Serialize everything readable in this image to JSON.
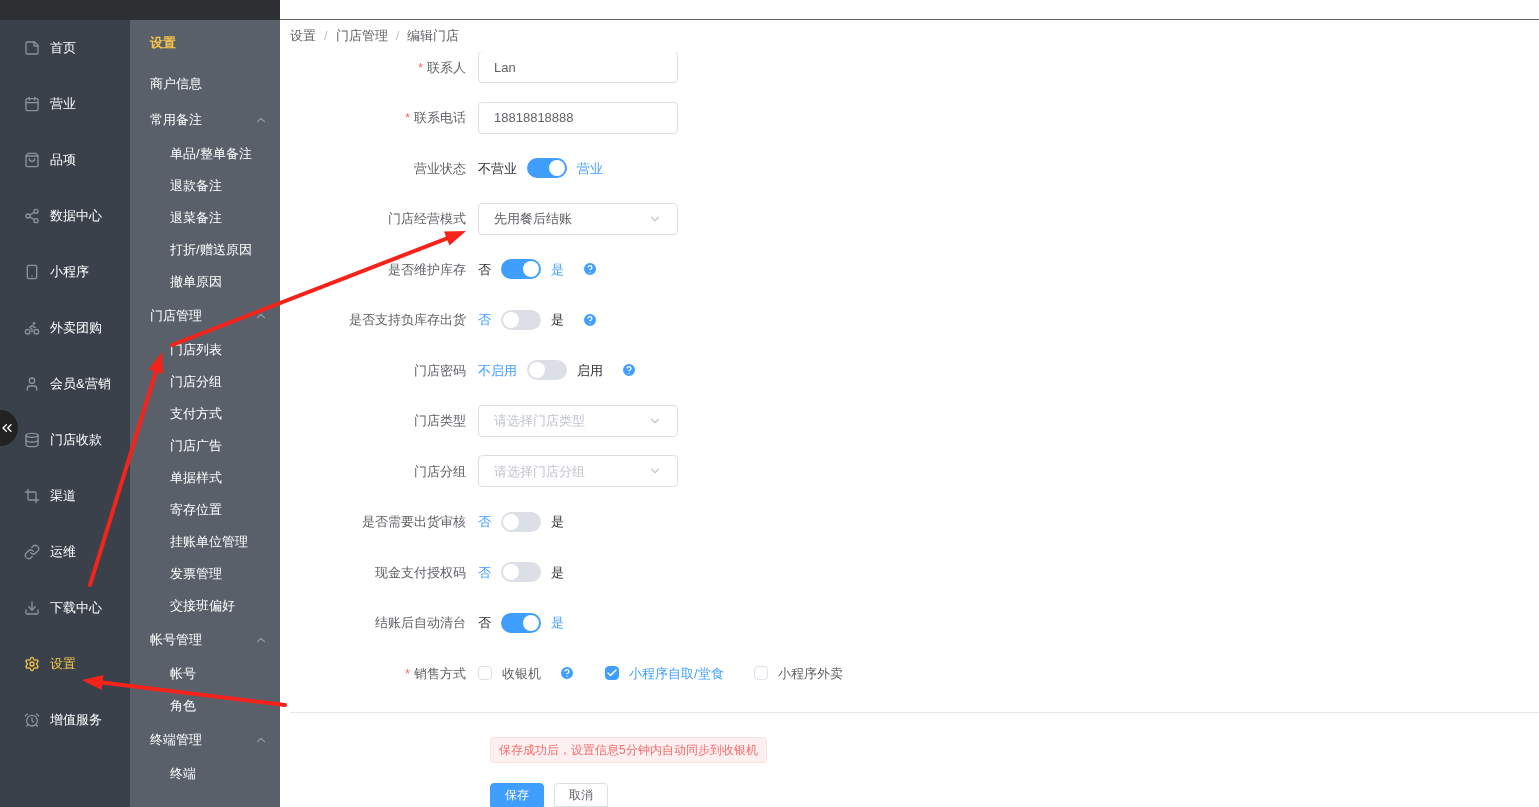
{
  "nav": [
    {
      "label": "首页",
      "selected": false
    },
    {
      "label": "营业",
      "selected": false
    },
    {
      "label": "品项",
      "selected": false
    },
    {
      "label": "数据中心",
      "selected": false
    },
    {
      "label": "小程序",
      "selected": false
    },
    {
      "label": "外卖团购",
      "selected": false
    },
    {
      "label": "会员&营销",
      "selected": false
    },
    {
      "label": "门店收款",
      "selected": false
    },
    {
      "label": "渠道",
      "selected": false
    },
    {
      "label": "运维",
      "selected": false
    },
    {
      "label": "下载中心",
      "selected": false
    },
    {
      "label": "设置",
      "selected": true
    },
    {
      "label": "增值服务",
      "selected": false
    }
  ],
  "subnav": {
    "title": "设置",
    "items": [
      {
        "kind": "link",
        "label": "商户信息"
      },
      {
        "kind": "group",
        "label": "常用备注",
        "expanded": true,
        "children": [
          {
            "label": "单品/整单备注"
          },
          {
            "label": "退款备注"
          },
          {
            "label": "退菜备注"
          },
          {
            "label": "打折/赠送原因"
          },
          {
            "label": "撤单原因"
          }
        ]
      },
      {
        "kind": "group",
        "label": "门店管理",
        "expanded": true,
        "children": [
          {
            "label": "门店列表"
          },
          {
            "label": "门店分组"
          },
          {
            "label": "支付方式"
          },
          {
            "label": "门店广告"
          },
          {
            "label": "单据样式"
          },
          {
            "label": "寄存位置"
          },
          {
            "label": "挂账单位管理"
          },
          {
            "label": "发票管理"
          },
          {
            "label": "交接班偏好"
          }
        ]
      },
      {
        "kind": "group",
        "label": "帐号管理",
        "expanded": true,
        "children": [
          {
            "label": "帐号"
          },
          {
            "label": "角色"
          }
        ]
      },
      {
        "kind": "group",
        "label": "终端管理",
        "expanded": true,
        "children": [
          {
            "label": "终端"
          }
        ]
      }
    ]
  },
  "breadcrumb": [
    "设置",
    "门店管理",
    "编辑门店"
  ],
  "breadcrumb_separator": "/",
  "form": [
    {
      "kind": "input",
      "label": "联系人",
      "required_mark": "*",
      "value": "Lan"
    },
    {
      "kind": "input",
      "label": "联系电话",
      "required_mark": "*",
      "value": "18818818888"
    },
    {
      "kind": "switch",
      "label": "营业状态",
      "off_label": "不营业",
      "on_label": "营业",
      "on": true,
      "help": false
    },
    {
      "kind": "select",
      "label": "门店经营模式",
      "value": "先用餐后结账"
    },
    {
      "kind": "switch",
      "label": "是否维护库存",
      "off_label": "否",
      "on_label": "是",
      "on": true,
      "help": true
    },
    {
      "kind": "switch",
      "label": "是否支持负库存出货",
      "off_label": "否",
      "on_label": "是",
      "on": false,
      "help": true
    },
    {
      "kind": "switch",
      "label": "门店密码",
      "off_label": "不启用",
      "on_label": "启用",
      "on": false,
      "help": true
    },
    {
      "kind": "select",
      "label": "门店类型",
      "placeholder": "请选择门店类型"
    },
    {
      "kind": "select",
      "label": "门店分组",
      "placeholder": "请选择门店分组"
    },
    {
      "kind": "switch",
      "label": "是否需要出货审核",
      "off_label": "否",
      "on_label": "是",
      "on": false,
      "help": false
    },
    {
      "kind": "switch",
      "label": "现金支付授权码",
      "off_label": "否",
      "on_label": "是",
      "on": false,
      "help": false
    },
    {
      "kind": "switch",
      "label": "结账后自动清台",
      "off_label": "否",
      "on_label": "是",
      "on": true,
      "help": false
    },
    {
      "kind": "checkboxes",
      "label": "销售方式",
      "required_mark": "*",
      "options": [
        {
          "label": "收银机",
          "checked": false,
          "help": true
        },
        {
          "label": "小程序自取/堂食",
          "checked": true,
          "help": false
        },
        {
          "label": "小程序外卖",
          "checked": false,
          "help": false
        }
      ]
    }
  ],
  "notice": "保存成功后，设置信息5分钟内自动同步到收银机",
  "buttons": [
    {
      "label": "保存",
      "kind": "primary"
    },
    {
      "label": "取消",
      "kind": "default"
    }
  ]
}
